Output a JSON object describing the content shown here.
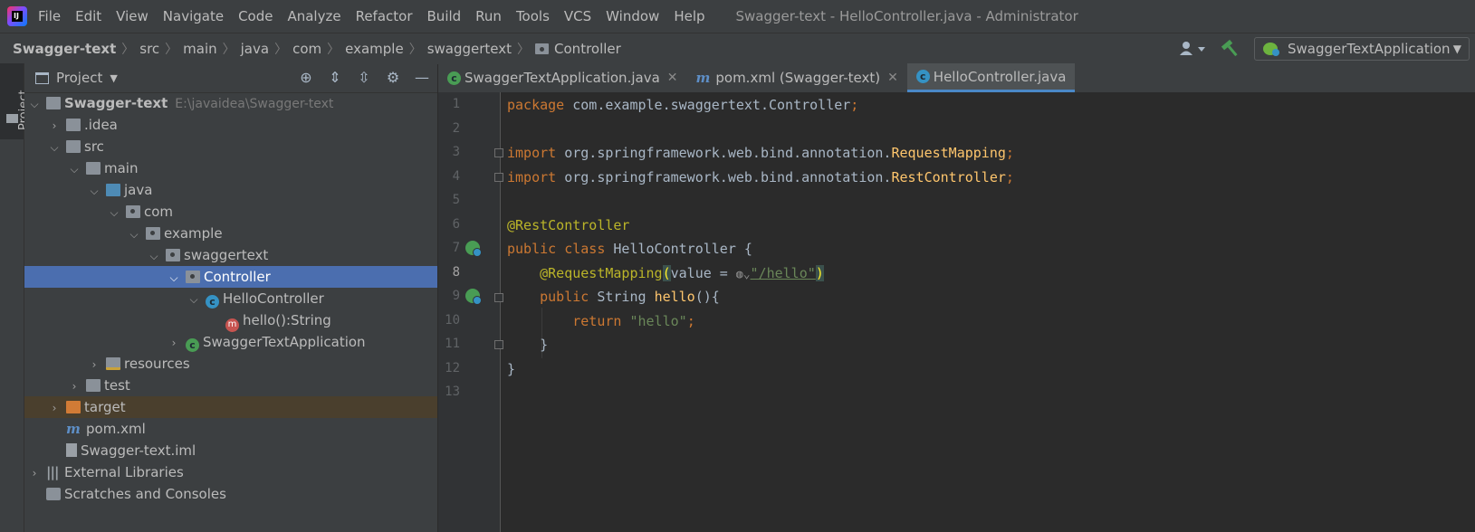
{
  "menu": {
    "items": [
      "File",
      "Edit",
      "View",
      "Navigate",
      "Code",
      "Analyze",
      "Refactor",
      "Build",
      "Run",
      "Tools",
      "VCS",
      "Window",
      "Help"
    ],
    "window_title": "Swagger-text - HelloController.java - Administrator"
  },
  "breadcrumb": [
    "Swagger-text",
    "src",
    "main",
    "java",
    "com",
    "example",
    "swaggertext",
    "Controller"
  ],
  "toolbar": {
    "run_config": "SwaggerTextApplication"
  },
  "sidebar": {
    "tab_label": "Project"
  },
  "project_panel": {
    "title": "Project",
    "tree": [
      {
        "label": "Swagger-text",
        "path": "E:\\javaidea\\Swagger-text"
      },
      {
        "label": ".idea"
      },
      {
        "label": "src"
      },
      {
        "label": "main"
      },
      {
        "label": "java"
      },
      {
        "label": "com"
      },
      {
        "label": "example"
      },
      {
        "label": "swaggertext"
      },
      {
        "label": "Controller"
      },
      {
        "label": "HelloController"
      },
      {
        "label": "hello():String"
      },
      {
        "label": "SwaggerTextApplication"
      },
      {
        "label": "resources"
      },
      {
        "label": "test"
      },
      {
        "label": "target"
      },
      {
        "label": "pom.xml"
      },
      {
        "label": "Swagger-text.iml"
      },
      {
        "label": "External Libraries"
      },
      {
        "label": "Scratches and Consoles"
      }
    ]
  },
  "editor_tabs": [
    {
      "label": "SwaggerTextApplication.java"
    },
    {
      "label": "pom.xml (Swagger-text)"
    },
    {
      "label": "HelloController.java"
    }
  ],
  "editor": {
    "line_numbers": [
      "1",
      "2",
      "3",
      "4",
      "5",
      "6",
      "7",
      "8",
      "9",
      "10",
      "11",
      "12",
      "13"
    ],
    "code": {
      "l1_kw": "package",
      "l1_rest": " com.example.swaggertext.Controller",
      "l3_kw": "import",
      "l3_pkg": " org.springframework.web.bind.annotation.",
      "l3_cls": "RequestMapping",
      "l4_kw": "import",
      "l4_pkg": " org.springframework.web.bind.annotation.",
      "l4_cls": "RestController",
      "semi": ";",
      "l6_ann": "@RestController",
      "l7_kw": "public class",
      "l7_rest": " HelloController {",
      "l8_ann": "@RequestMapping",
      "l8_paren_open": "(",
      "l8_param": "value = ",
      "l8_str": "\"/hello\"",
      "l8_paren_close": ")",
      "l9_kw": "public",
      "l9_type": " String ",
      "l9_fn": "hello",
      "l9_rest": "(){",
      "l10_kw": "return",
      "l10_str": " \"hello\"",
      "l11": "}",
      "l12": "}"
    }
  }
}
